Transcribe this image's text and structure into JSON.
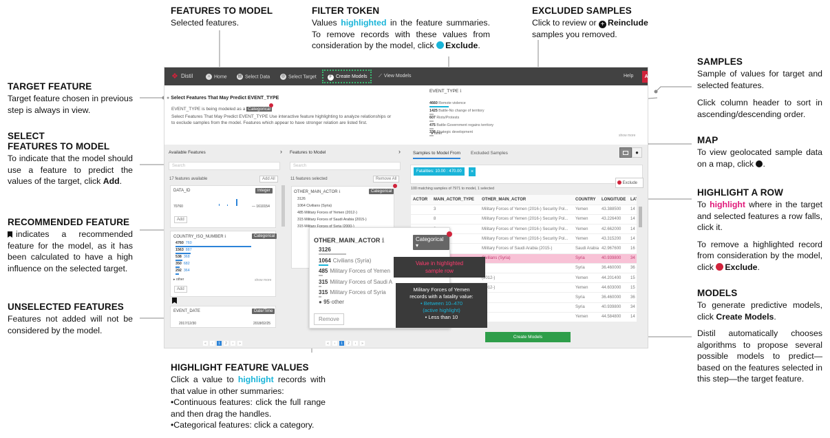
{
  "annotations": {
    "features_to_model": {
      "title": "FEATURES TO MODEL",
      "text": "Selected features."
    },
    "filter_token": {
      "title": "FILTER TOKEN",
      "t1": "Values ",
      "hl": "highlighted",
      "t2": " in the feature summaries. To remove records with these values from consideration by the model, click ",
      "btn": "Exclude",
      "t3": "."
    },
    "excluded_samples": {
      "title": "EXCLUDED SAMPLES",
      "t1": "Click to review or ",
      "btn": "Reinclude",
      "t2": " samples you removed."
    },
    "samples": {
      "title": "SAMPLES",
      "p1": "Sample of values for target and selected features.",
      "p2": "Click column header to sort in ascending/descending order."
    },
    "map": {
      "title": "MAP",
      "text": "To view geolocated sample data on a map, click"
    },
    "highlight_row": {
      "title": "HIGHLIGHT A ROW",
      "t1": "To ",
      "hl": "highlight",
      "t2": " where in the target and selected features a row falls, click it.",
      "p2a": "To remove a highlighted record from consideration by the model, click ",
      "btn": "Exclude",
      "p2b": "."
    },
    "models": {
      "title": "MODELS",
      "t1": "To generate predictive models, click ",
      "btn": "Create Models",
      "t2": ".",
      "p2": "Distil automatically chooses algorithms to propose several possible models to predict—based on the features selected in this step—the target feature."
    },
    "target_feature": {
      "title": "TARGET FEATURE",
      "text": "Target feature chosen in previous step is always in view."
    },
    "select_features": {
      "title1": "SELECT",
      "title2": "FEATURES TO MODEL",
      "t1": "To indicate that the model should use a feature to predict the values of the target, click ",
      "btn": "Add",
      "t2": "."
    },
    "recommended": {
      "title": "RECOMMENDED FEATURE",
      "text": "indicates a recommended feature for the model, as it has been calculated to have a high influence on the selected target."
    },
    "unselected": {
      "title": "UNSELECTED FEATURES",
      "text": "Features not added will not be considered by the model."
    },
    "highlight_values": {
      "title": "HIGHLIGHT FEATURE VALUES",
      "t1": "Click a value to ",
      "hl": "highlight",
      "t2": " records with that value in other summaries:",
      "b1": "•Continuous features: click the full range and then drag the handles.",
      "b2": "•Categorical features: click a category."
    }
  },
  "app": {
    "brand": "Distil",
    "nav": [
      "Home",
      "Select Data",
      "Select Target",
      "Create Models",
      "View Models"
    ],
    "help": "Help",
    "abort": "Abort",
    "header": {
      "title": "Select Features That May Predict EVENT_TYPE",
      "l1a": "EVENT_TYPE is being modeled as a",
      "l1tag": "Categorical",
      "l2": "Select Features That May Predict EVENT_TYPE Use interactive feature highlighting to analyze relationships or to exclude samples from the model. Features which appear to have stronger relation are listed first."
    },
    "target": {
      "name": "EVENT_TYPE",
      "rows": [
        {
          "n": "4660",
          "l": "Remote violence"
        },
        {
          "n": "1425",
          "l": "Battle-No change of territory"
        },
        {
          "n": "607",
          "l": "Riots/Protests"
        },
        {
          "n": "475",
          "l": "Battle-Government regains territory"
        },
        {
          "n": "338",
          "l": "Strategic development"
        }
      ],
      "other": "other",
      "more": "show more"
    },
    "available": {
      "title": "Available Features",
      "search": "Search",
      "count": "17 features available",
      "addall": "Add All",
      "f1": "DATA_ID",
      "f1tag": "Integer",
      "f1min": "70760",
      "f1max": "1610154",
      "add": "Add",
      "f2": "COUNTRY_ISO_NUMBER",
      "f2tag": "Categorical",
      "f2rows": [
        {
          "n": "4760",
          "v": "760"
        },
        {
          "n": "1563",
          "v": "887"
        },
        {
          "n": "538",
          "v": "368"
        },
        {
          "n": "350",
          "v": "682"
        },
        {
          "n": "292",
          "v": "364"
        }
      ],
      "other": "other",
      "more": "show more",
      "f3": "EVENT_DATE",
      "f3tag": "Date/Time",
      "f3min": "2017/12/30",
      "f3max": "2018/02/25"
    },
    "selected": {
      "title": "Features to Model",
      "search": "Search",
      "count": "11 features selected",
      "removeall": "Remove All",
      "small_name": "OTHER_MAIN_ACTOR",
      "small_tag": "Categorical",
      "small_rows": [
        "3126",
        "1064 Civilians (Syria)",
        "485 Military Forces of Yemen (2012-)",
        "315 Military Forces of Saudi Arabia (2015-)",
        "315 Military Forces of Syria (2000-)"
      ]
    },
    "popup": {
      "name": "OTHER_MAIN_ACTOR",
      "tag": "Categorical",
      "rows": [
        {
          "n": "3126",
          "l": ""
        },
        {
          "n": "1064",
          "l": "Civilians (Syria)"
        },
        {
          "n": "485",
          "l": "Military Forces of Yemen"
        },
        {
          "n": "315",
          "l": "Military Forces of Saudi A"
        },
        {
          "n": "315",
          "l": "Military Forces of Syria"
        }
      ],
      "other_n": "95",
      "other": "other",
      "remove": "Remove"
    },
    "tip1": {
      "l1": "Value in highlighted",
      "l2": "sample row"
    },
    "tip2": {
      "l1": "Military Forces of Yemen",
      "l2": "records with a fatality  value:",
      "l3": "• Between 10–470",
      "l4": "(active highlight)",
      "l5": "• Less than 10"
    },
    "samples": {
      "tab1": "Samples to Model From",
      "tab2": "Excluded Samples",
      "token": "Fatalities: 10.00 : 470.00",
      "matching": "100 matching samples of 7971 to model, 1 selected",
      "exclude": "Exclude",
      "cols": [
        "ACTOR",
        "MAIN_ACTOR_TYPE",
        "OTHER_MAIN_ACTOR",
        "COUNTRY",
        "LONGITUDE",
        "LATI"
      ],
      "rows": [
        [
          "",
          "3",
          "Military Forces of Yemen (2016-) Security Pol...",
          "Yemen",
          "43.388500",
          "14"
        ],
        [
          "",
          "8",
          "Military Forces of Yemen (2016-) Security Pol...",
          "Yemen",
          "43.226400",
          "14"
        ],
        [
          "",
          "8",
          "Military Forces of Yemen (2016-) Security Pol...",
          "Yemen",
          "42.662000",
          "14"
        ],
        [
          "",
          "8",
          "Military Forces of Yemen (2016-) Security Pol...",
          "Yemen",
          "43.315200",
          "14"
        ],
        [
          "",
          "",
          "Military Forces of Saudi Arabia (2015-)",
          "Saudi Arabia",
          "42.967600",
          "16"
        ],
        [
          "",
          "",
          "Civilians (Syria)",
          "Syria",
          "40.939800",
          "34"
        ],
        [
          "",
          "",
          "",
          "Syria",
          "36.460000",
          "36"
        ],
        [
          "",
          "",
          "(2012-)",
          "Yemen",
          "44.201400",
          "15"
        ],
        [
          "",
          "",
          "(2012-)",
          "Yemen",
          "44.603000",
          "15"
        ],
        [
          "",
          "",
          "",
          "Syria",
          "36.460000",
          "36"
        ],
        [
          "",
          "",
          "",
          "Syria",
          "40.939800",
          "34"
        ],
        [
          "",
          "",
          "",
          "Yemen",
          "44.584800",
          "14"
        ]
      ],
      "pages": [
        "«",
        "‹",
        "1",
        "2",
        "›",
        "»"
      ]
    },
    "create": "Create Models",
    "pager": [
      "«",
      "‹",
      "1",
      "2",
      "›",
      "»"
    ]
  }
}
